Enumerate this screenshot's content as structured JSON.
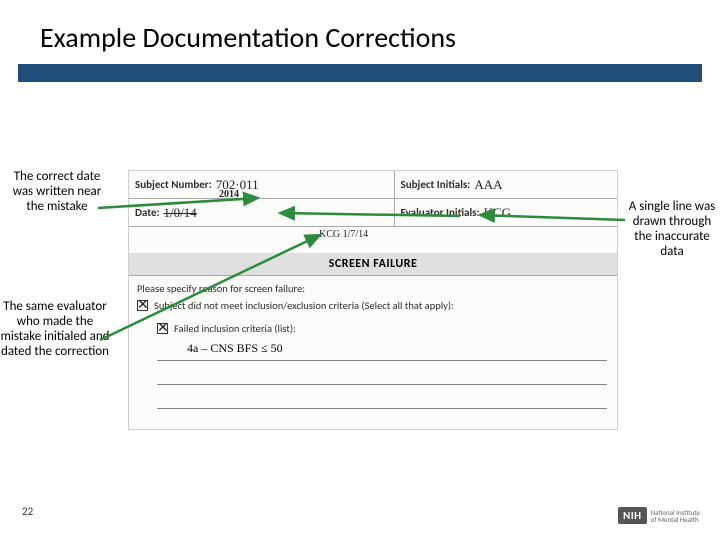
{
  "title": "Example Documentation Corrections",
  "captions": {
    "left1": "The correct date was written near the mistake",
    "left2": "The same evaluator who made the mistake initialed and dated the correction",
    "right": "A single line was drawn through the inaccurate data"
  },
  "form": {
    "row1": {
      "subjnum_label": "Subject Number:",
      "subjnum_value": "702·011",
      "subjinit_label": "Subject Initials:",
      "subjinit_value": "AAA"
    },
    "row2": {
      "date_label": "Date:",
      "date_value_strikethrough": "1/0/14",
      "date_correction": "2014",
      "eval_label": "Evaluator Initials:",
      "eval_value": "KCG"
    },
    "correction_initial": "KCG  1/7/14",
    "banner": "SCREEN FAILURE",
    "prompt": "Please specify reason for screen failure:",
    "check1": "Subject did not meet inclusion/exclusion criteria (Select all that apply):",
    "check2": "Failed inclusion criteria (list):",
    "writein": "4a  –  CNS BFS  ≤  50"
  },
  "page_number": "22",
  "logo": {
    "badge": "NIH",
    "line1": "National Institute",
    "line2": "of Mental Health"
  }
}
